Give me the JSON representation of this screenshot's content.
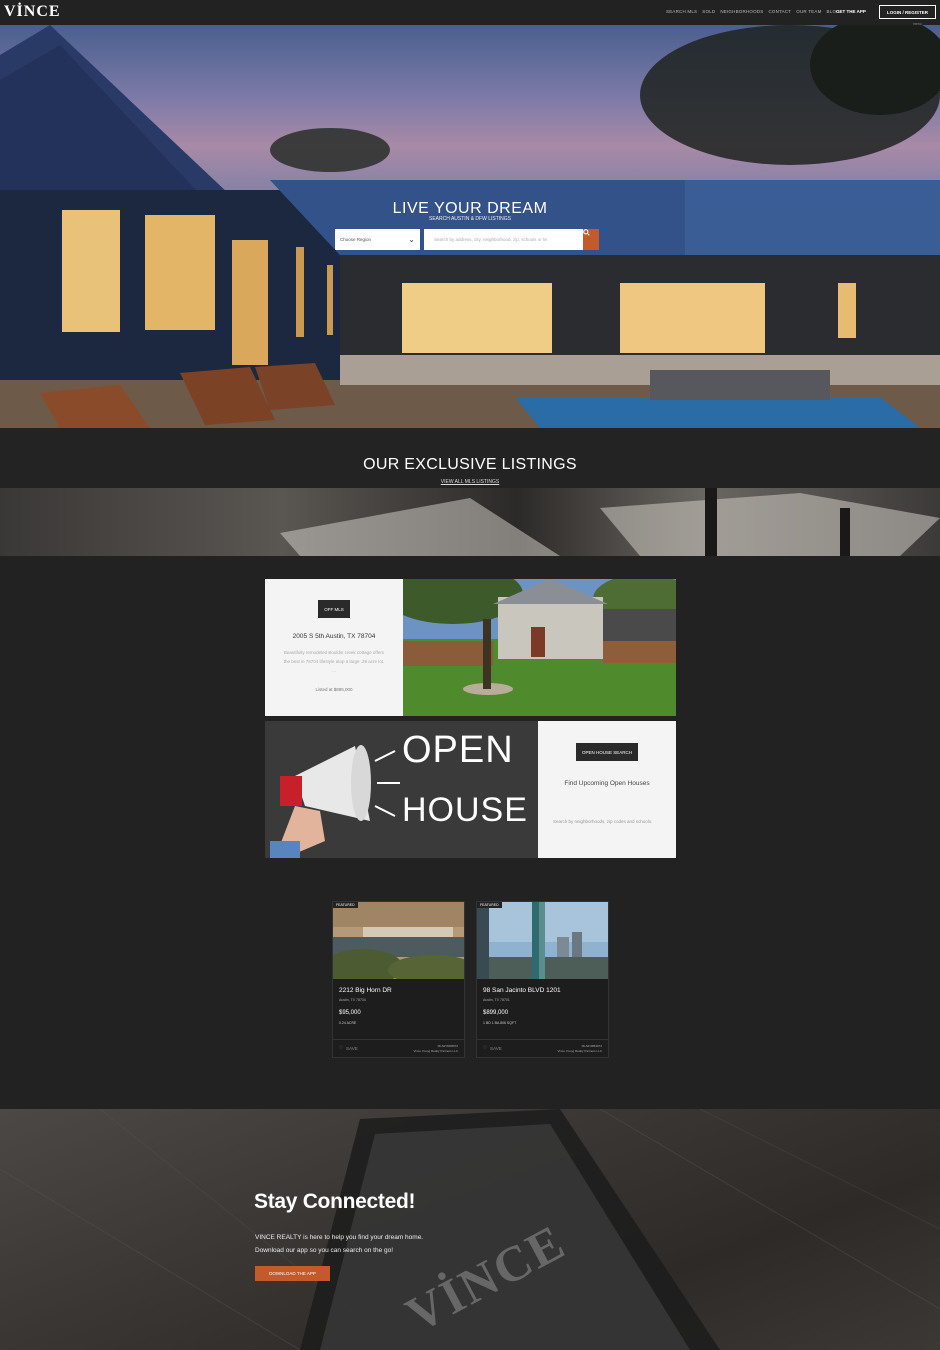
{
  "nav": {
    "logo": "VİNCE",
    "links": [
      "SEARCH MLS",
      "SOLD",
      "NEIGHBORHOODS",
      "CONTACT",
      "OUR TEAM",
      "BLOG"
    ],
    "get_app": "GET THE APP",
    "login": "LOGIN / REGISTER",
    "menu_hint": "menu"
  },
  "hero": {
    "title": "LIVE YOUR DREAM",
    "subtitle": "SEARCH AUSTIN & DFW LISTINGS",
    "region_placeholder": "Choose Region",
    "search_placeholder": "Search by address, city, neighborhood, zip, schools or M"
  },
  "exclusive": {
    "title": "OUR EXCLUSIVE LISTINGS",
    "link": "VIEW ALL MLS LISTINGS"
  },
  "offmls_card": {
    "badge": "OFF MLS",
    "address": "2005 S 5th Austin, TX 78704",
    "description": "Beautifully remodeled Bouldin creek cottage offers the best in 78704 lifestyle atop a large .29 acre lot. ...",
    "price": "Listed at $895,000"
  },
  "openhouse_card": {
    "badge": "OPEN HOUSE SEARCH",
    "title": "Find Upcoming Open Houses",
    "description": "Search by neighborhoods, zip codes and schools.",
    "graphic_word1": "OPEN",
    "graphic_word2": "HOUSE"
  },
  "featured": [
    {
      "tag": "FEATURED",
      "address": "2212 Big Horn DR",
      "city": "Austin, TX 78734",
      "price": "$95,000",
      "meta": "0.24 ACRE",
      "save": "SAVE",
      "mls_id": "MLS# 8008976",
      "brokerage": "Vince Young Realty Partners LLC"
    },
    {
      "tag": "FEATURED",
      "address": "98 San Jacinto BLVD 1201",
      "city": "Austin, TX 78701",
      "price": "$899,000",
      "meta": "1 BD   1 BA   806 SQFT",
      "save": "SAVE",
      "mls_id": "MLS# 9853072",
      "brokerage": "Vince Young Realty Partners LLC"
    }
  ],
  "stay": {
    "title": "Stay Connected!",
    "text_line1": "VINCE REALTY is here to help you find your dream home.",
    "text_line2": "Download our app so you can search on the go!",
    "button": "DOWNLOAD THE APP",
    "phone_logo": "VİNCE"
  },
  "colors": {
    "accent": "#c25a2c",
    "dark_bg": "#222222",
    "card_bg": "#f4f4f4"
  }
}
